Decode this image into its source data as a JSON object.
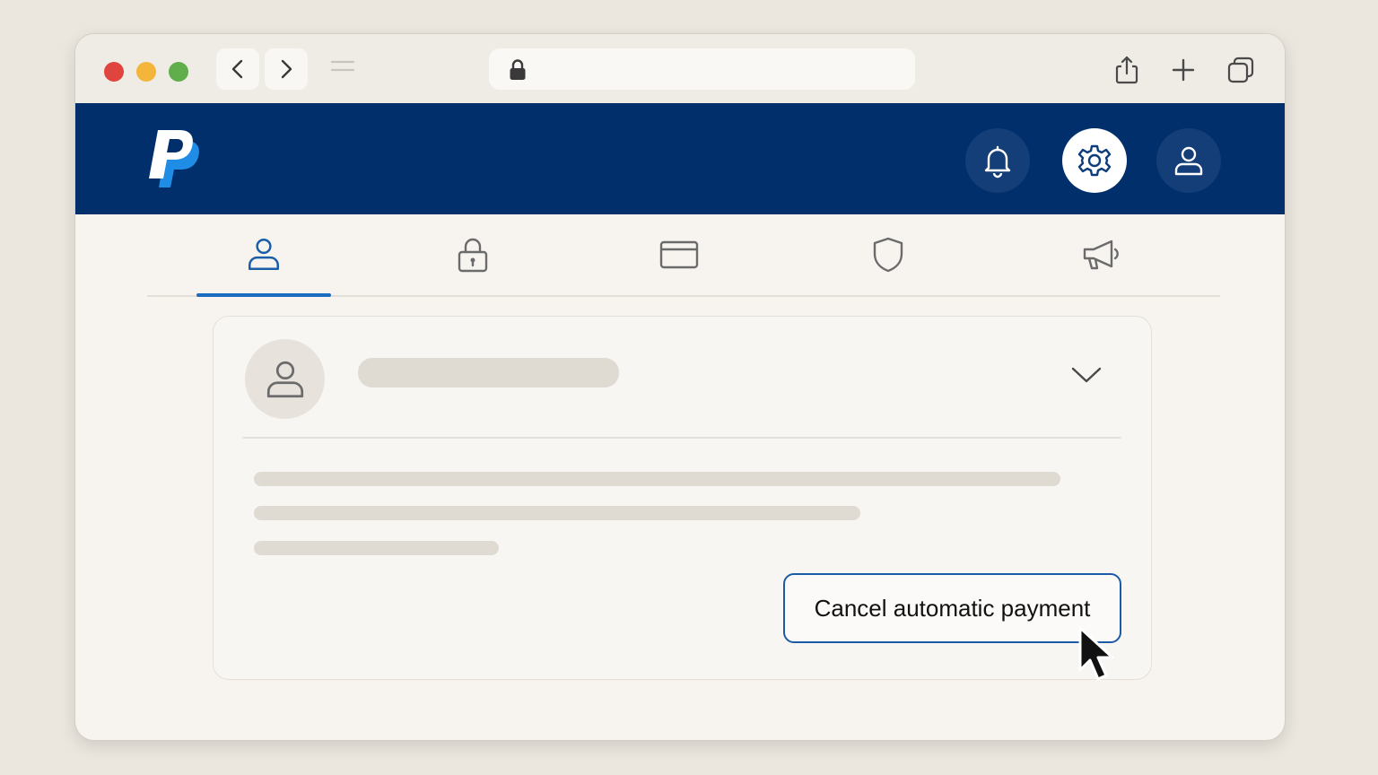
{
  "window": {
    "traffic_colors": [
      "#e0443e",
      "#f4b63a",
      "#5fae4b"
    ],
    "nav": {
      "back_icon": "chevron-left-icon",
      "forward_icon": "chevron-right-icon"
    },
    "address_bar": {
      "icon": "lock-icon",
      "url": ""
    },
    "toolbar_icons": [
      "share-icon",
      "plus-icon",
      "tabs-overview-icon"
    ]
  },
  "header": {
    "brand": "PayPal",
    "brand_colors": {
      "navy": "#002f6c",
      "light_blue": "#1f8ce6"
    },
    "buttons": [
      {
        "icon": "bell-icon",
        "active": false
      },
      {
        "icon": "gear-icon",
        "active": true
      },
      {
        "icon": "user-icon",
        "active": false
      }
    ]
  },
  "tabs": {
    "items": [
      {
        "icon": "user-icon",
        "active": true
      },
      {
        "icon": "lock-icon",
        "active": false
      },
      {
        "icon": "credit-card-icon",
        "active": false
      },
      {
        "icon": "shield-icon",
        "active": false
      },
      {
        "icon": "megaphone-icon",
        "active": false
      }
    ],
    "accent": "#1b6cc0"
  },
  "card": {
    "avatar_icon": "user-icon",
    "expand_icon": "chevron-down-icon",
    "action_button": {
      "label": "Cancel automatic payment",
      "border_color": "#1d5aa5"
    }
  }
}
